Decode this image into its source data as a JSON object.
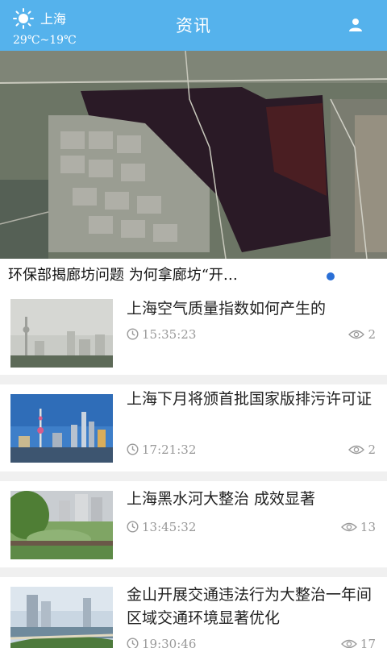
{
  "header": {
    "city": "上海",
    "temperature": "29℃~19℃",
    "title": "资讯",
    "weather_icon": "sun-icon",
    "user_icon": "user-icon",
    "color": "#55b2ec"
  },
  "hero": {
    "title": "环保部揭廊坊问题 为何拿廊坊“开…",
    "indicator_color": "#2a6fd6"
  },
  "news": [
    {
      "title": "上海空气质量指数如何产生的",
      "time": "15:35:23",
      "views": "2"
    },
    {
      "title": "上海下月将颁首批国家版排污许可证",
      "time": "17:21:32",
      "views": "2"
    },
    {
      "title": "上海黑水河大整治 成效显著",
      "time": "13:45:32",
      "views": "13"
    },
    {
      "title": "金山开展交通违法行为大整治一年间 区域交通环境显著优化",
      "time": "19:30:46",
      "views": "17"
    }
  ]
}
